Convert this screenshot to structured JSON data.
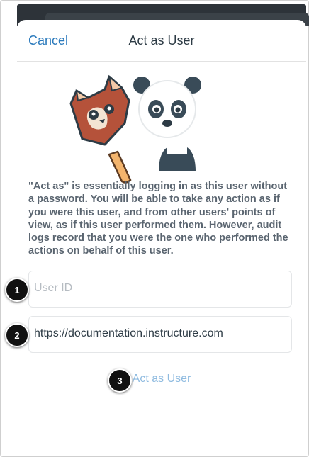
{
  "header": {
    "cancel_label": "Cancel",
    "title": "Act as User"
  },
  "description": "\"Act as\" is essentially logging in as this user without a password. You will be able to take any action as if you were this user, and from other users' points of view, as if this user performed them. However, audit logs record that you were the one who performed the actions on behalf of this user.",
  "form": {
    "user_id": {
      "value": "",
      "placeholder": "User ID"
    },
    "domain": {
      "value": "https://documentation.instructure.com",
      "placeholder": ""
    },
    "submit_label": "Act as User"
  },
  "step_markers": [
    "1",
    "2",
    "3"
  ],
  "colors": {
    "link": "#2b7abc",
    "disabled_button": "#8fbbe0",
    "text": "#2d3b45",
    "description": "#5a6570"
  },
  "illustration": {
    "icon_names": [
      "red-panda-popsicle-icon",
      "panda-icon"
    ]
  }
}
